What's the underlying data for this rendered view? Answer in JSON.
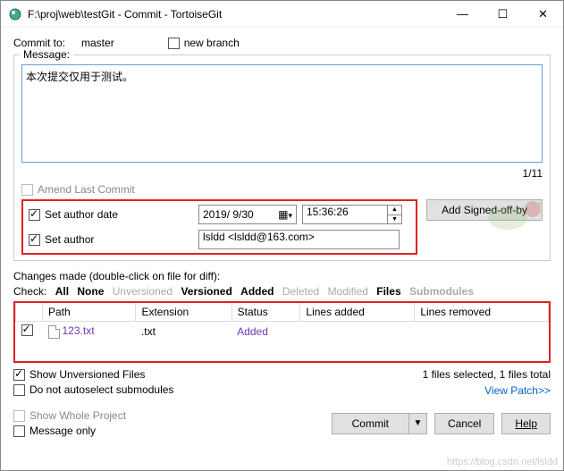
{
  "window": {
    "title": "F:\\proj\\web\\testGit - Commit - TortoiseGit"
  },
  "commit_to": {
    "label": "Commit to:",
    "branch": "master"
  },
  "new_branch_label": "new branch",
  "message": {
    "group_title": "Message:",
    "text": "本次提交仅用于测试。",
    "counter": "1/11",
    "amend_label": "Amend Last Commit",
    "set_author_date_label": "Set author date",
    "set_author_label": "Set author",
    "date_value": "2019/ 9/30",
    "time_value": "15:36:26",
    "author_value": "lsldd <lsldd@163.com>",
    "signed_off_label": "Add Signed-off-by"
  },
  "changes": {
    "label": "Changes made (double-click on file for diff):",
    "check_label": "Check:",
    "filters": {
      "all": "All",
      "none": "None",
      "unversioned": "Unversioned",
      "versioned": "Versioned",
      "added": "Added",
      "deleted": "Deleted",
      "modified": "Modified",
      "files": "Files",
      "submodules": "Submodules"
    },
    "columns": {
      "path": "Path",
      "extension": "Extension",
      "status": "Status",
      "lines_added": "Lines added",
      "lines_removed": "Lines removed"
    },
    "rows": [
      {
        "checked": true,
        "path": "123.txt",
        "extension": ".txt",
        "status": "Added",
        "lines_added": "",
        "lines_removed": ""
      }
    ],
    "show_unversioned": "Show Unversioned Files",
    "no_autoselect": "Do not autoselect submodules",
    "summary": "1 files selected, 1 files total",
    "view_patch": "View Patch>>"
  },
  "bottom": {
    "show_whole": "Show Whole Project",
    "message_only": "Message only",
    "commit": "Commit",
    "cancel": "Cancel",
    "help": "Help"
  },
  "watermark": "https://blog.csdn.net/lsldd"
}
